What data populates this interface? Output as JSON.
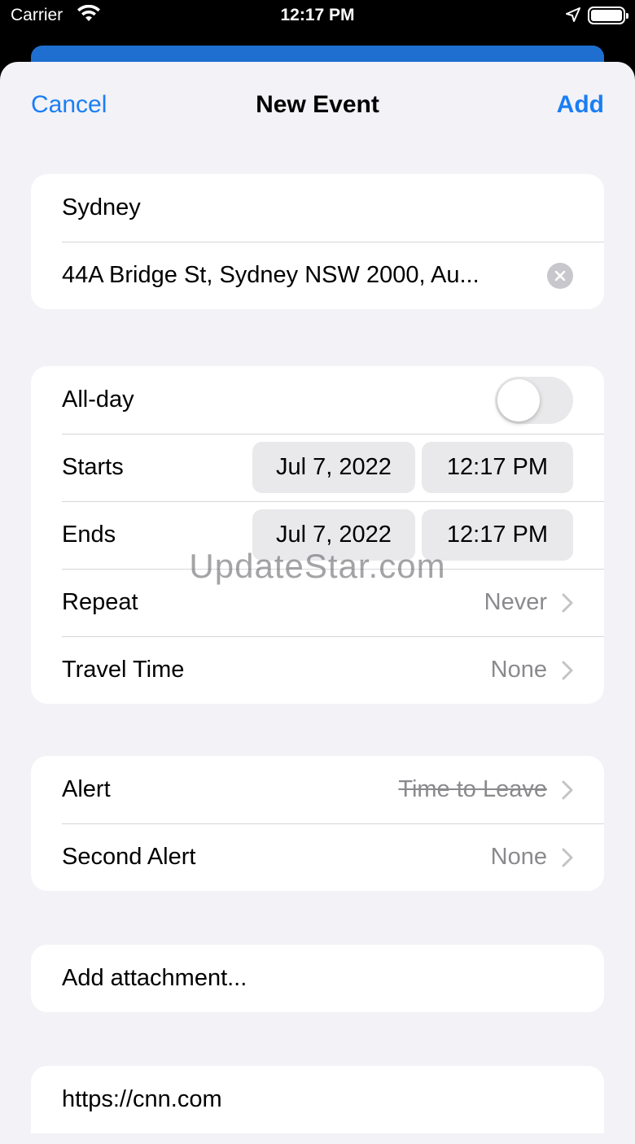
{
  "status_bar": {
    "carrier": "Carrier",
    "time": "12:17 PM"
  },
  "nav": {
    "cancel": "Cancel",
    "title": "New Event",
    "add": "Add"
  },
  "event": {
    "title": "Sydney",
    "location": "44A Bridge St, Sydney NSW 2000, Au..."
  },
  "schedule": {
    "all_day_label": "All-day",
    "all_day_on": false,
    "starts_label": "Starts",
    "starts_date": "Jul 7, 2022",
    "starts_time": "12:17 PM",
    "ends_label": "Ends",
    "ends_date": "Jul 7, 2022",
    "ends_time": "12:17 PM",
    "repeat_label": "Repeat",
    "repeat_value": "Never",
    "travel_label": "Travel Time",
    "travel_value": "None"
  },
  "alerts": {
    "alert_label": "Alert",
    "alert_value": "Time to Leave",
    "second_label": "Second Alert",
    "second_value": "None"
  },
  "attachment": {
    "label": "Add attachment..."
  },
  "url": {
    "value": "https://cnn.com"
  },
  "watermark": "UpdateStar.com",
  "colors": {
    "accent": "#1a7ef5",
    "background": "#f2f2f7",
    "secondary_text": "#8a8a8e"
  },
  "icons": [
    "wifi-icon",
    "location-arrow-icon",
    "battery-icon",
    "clear-icon",
    "chevron-right-icon"
  ]
}
